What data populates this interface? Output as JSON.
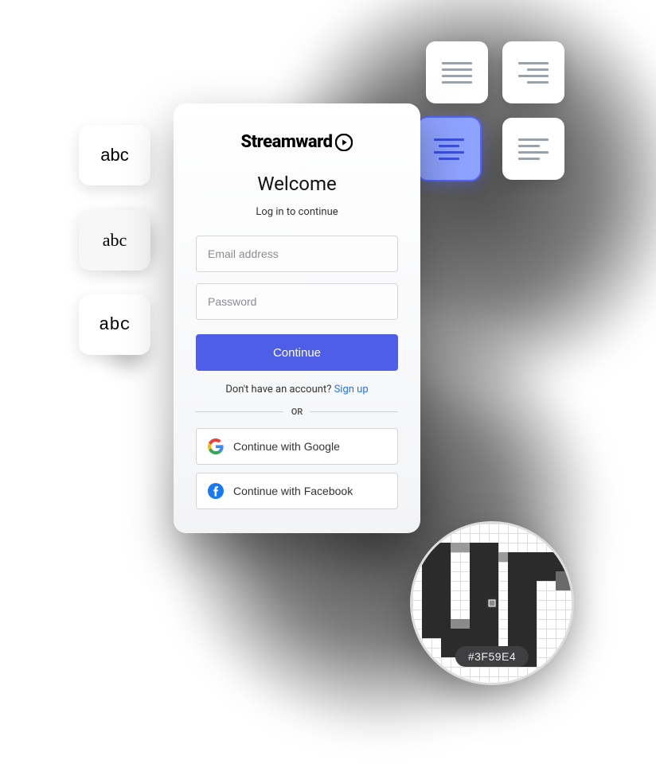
{
  "font_samples": {
    "sans": "abc",
    "serif": "abc",
    "mono": "abc"
  },
  "alignment_options": [
    "justify",
    "right",
    "center",
    "left"
  ],
  "alignment_selected": "center",
  "brand": "Streamward",
  "login": {
    "title": "Welcome",
    "subtitle": "Log in to continue",
    "email_placeholder": "Email address",
    "password_placeholder": "Password",
    "continue_label": "Continue",
    "signup_prompt": "Don't have an account? ",
    "signup_link": "Sign up",
    "divider": "OR",
    "google_label": "Continue with Google",
    "facebook_label": "Continue with Facebook"
  },
  "color_picker": {
    "sampled_hex": "#3F59E4"
  },
  "colors": {
    "primary": "#4f5ee6",
    "link": "#2e6ff2",
    "selection": "#8ea2ff"
  }
}
